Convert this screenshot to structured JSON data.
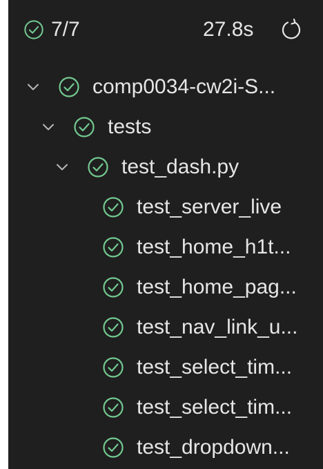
{
  "colors": {
    "pass": "#73c991",
    "text": "#e6e6e6",
    "chevron": "#b8b8b8",
    "background": "#1f1f1f"
  },
  "summary": {
    "count": "7/7",
    "duration": "27.8s",
    "status_icon": "pass-circle-icon",
    "rerun_icon": "refresh-icon"
  },
  "tree": {
    "project": {
      "label": "comp0034-cw2i-S...",
      "icon": "pass-circle-icon",
      "expanded": true
    },
    "folder": {
      "label": "tests",
      "icon": "pass-circle-icon",
      "expanded": true
    },
    "file": {
      "label": "test_dash.py",
      "icon": "pass-circle-icon",
      "expanded": true
    },
    "tests": [
      {
        "label": "test_server_live",
        "status": "passed"
      },
      {
        "label": "test_home_h1t...",
        "status": "passed"
      },
      {
        "label": "test_home_pag...",
        "status": "passed"
      },
      {
        "label": "test_nav_link_u...",
        "status": "passed"
      },
      {
        "label": "test_select_tim...",
        "status": "passed"
      },
      {
        "label": "test_select_tim...",
        "status": "passed"
      },
      {
        "label": "test_dropdown...",
        "status": "passed"
      }
    ]
  }
}
